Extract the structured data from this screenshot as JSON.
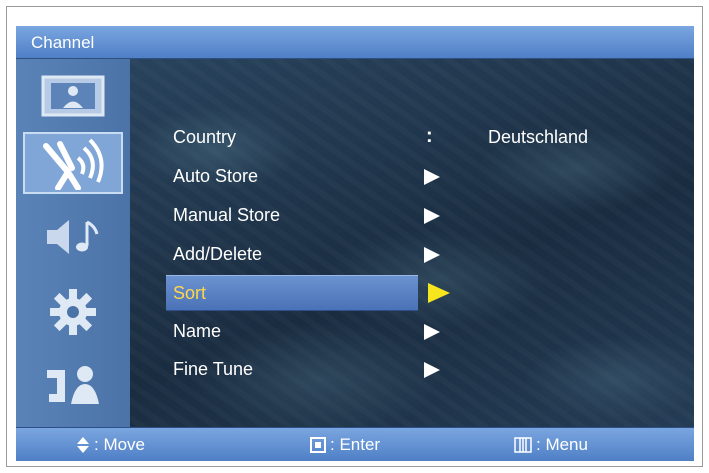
{
  "window": {
    "title": "Channel"
  },
  "sidebar": {
    "items": [
      {
        "icon": "picture-icon",
        "active": false
      },
      {
        "icon": "antenna-icon",
        "active": true
      },
      {
        "icon": "speaker-music-icon",
        "active": false
      },
      {
        "icon": "gear-icon",
        "active": false
      },
      {
        "icon": "input-icon",
        "active": false
      }
    ]
  },
  "menu": {
    "items": [
      {
        "label": "Country",
        "separator": ":",
        "value": "Deutschland"
      },
      {
        "label": "Auto Store"
      },
      {
        "label": "Manual Store"
      },
      {
        "label": "Add/Delete"
      },
      {
        "label": "Sort",
        "selected": true
      },
      {
        "label": "Name"
      },
      {
        "label": "Fine Tune"
      }
    ]
  },
  "footer": {
    "move": ": Move",
    "enter": ": Enter",
    "menu": ": Menu"
  },
  "colors": {
    "accent": "#4f7fc6",
    "selected_text": "#ffd84a",
    "selected_arrow": "#f7e51e"
  }
}
